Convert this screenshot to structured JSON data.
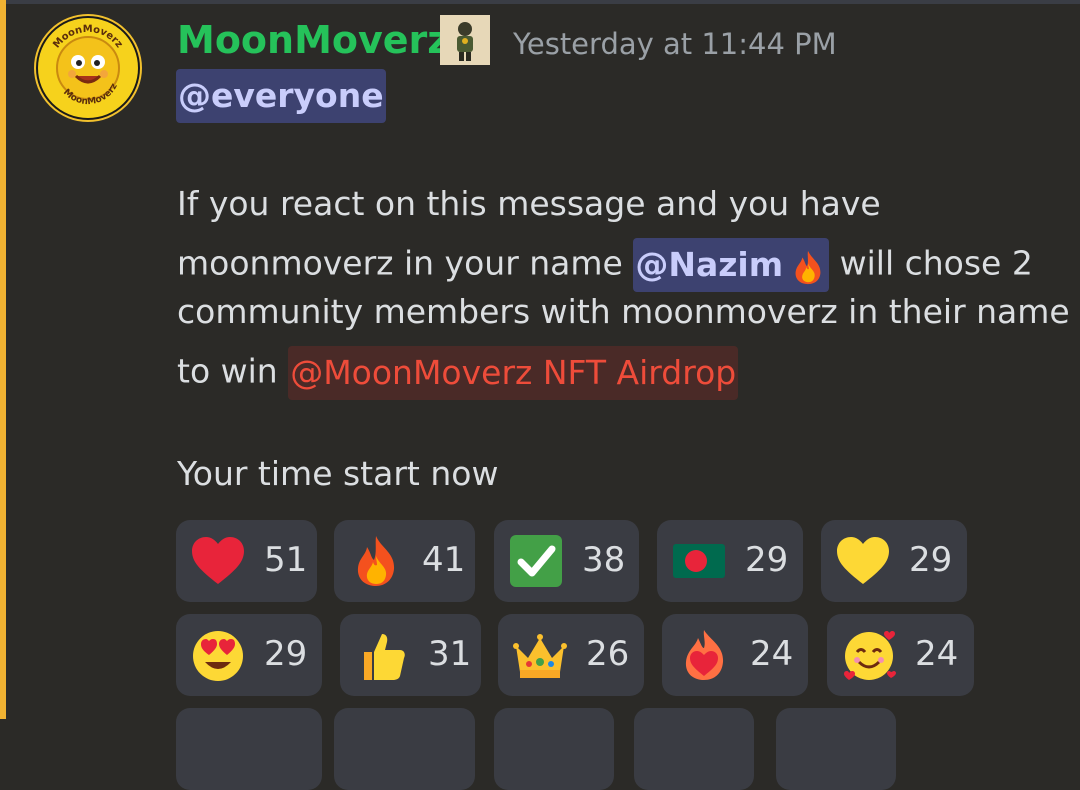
{
  "message": {
    "author": "MoonMoverz",
    "timestamp": "Yesterday at 11:44 PM",
    "mention_everyone": "@everyone",
    "line1": "If you react on this message and you have",
    "line2_pre": "moonmoverz in your name ",
    "line2_mention": "@Nazim",
    "line2_post": " will chose 2",
    "line3": "community members with moonmoverz in their name",
    "line4_pre": "to win ",
    "line4_role": "@MoonMoverz NFT Airdrop",
    "line5": "Your time start now",
    "avatar_text_top": "MoonMoverz",
    "avatar_text_bottom": "MoonMoverz"
  },
  "colors": {
    "username": "#25c25a",
    "left_accent": "#f0b232",
    "mention_bg": "#3d4270",
    "role_color": "#ee4c3a"
  },
  "reactions": [
    {
      "icon": "red-heart-icon",
      "count": "51"
    },
    {
      "icon": "fire-icon",
      "count": "41"
    },
    {
      "icon": "check-mark-icon",
      "count": "38"
    },
    {
      "icon": "bangladesh-flag-icon",
      "count": "29"
    },
    {
      "icon": "yellow-heart-icon",
      "count": "29"
    },
    {
      "icon": "heart-eyes-icon",
      "count": "29"
    },
    {
      "icon": "thumbs-up-icon",
      "count": "31"
    },
    {
      "icon": "crown-icon",
      "count": "26"
    },
    {
      "icon": "heart-on-fire-icon",
      "count": "24"
    },
    {
      "icon": "smiling-hearts-icon",
      "count": "24"
    }
  ]
}
